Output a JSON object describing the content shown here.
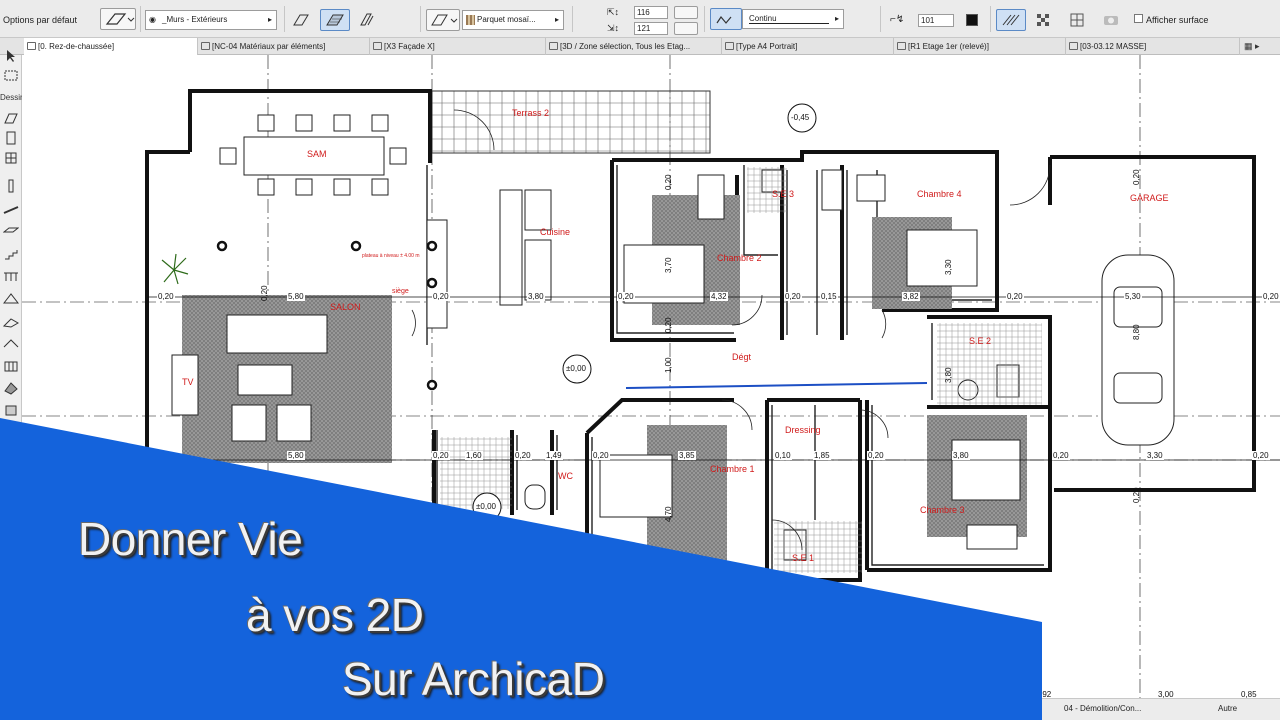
{
  "infobox": {
    "options_label": "Options par défaut",
    "layer_select": "_Murs - Extérieurs",
    "surface_select": "Parquet mosaï...",
    "height_top": "116",
    "height_bottom": "121",
    "line_type": "Continu",
    "pen_value": "101",
    "show_surface_label": "Afficher surface"
  },
  "tabs": [
    {
      "label": "[0. Rez-de-chaussée]"
    },
    {
      "label": "[NC-04 Matériaux par éléments]"
    },
    {
      "label": "[X3 Façade X]"
    },
    {
      "label": "[3D / Zone sélection, Tous les Etag..."
    },
    {
      "label": "[Type A4 Portrait]"
    },
    {
      "label": "[R1 Etage 1er (relevé)]"
    },
    {
      "label": "[03-03.12 MASSE]"
    }
  ],
  "toolbox": {
    "dessin_label": "Dessin"
  },
  "rooms": {
    "sam": "SAM",
    "terrasse": "Terrass 2",
    "cuisine": "Cuisine",
    "salon": "SALON",
    "chambre2": "Chambre 2",
    "chambre4": "Chambre 4",
    "se3": "S.E 3",
    "garage": "GARAGE",
    "se2": "S.E 2",
    "degt": "Dégt",
    "dressing": "Dressing",
    "chambre1": "Chambre 1",
    "chambre3": "Chambre 3",
    "se1": "S.E 1",
    "wc": "WC",
    "tv": "TV",
    "siege": "siège",
    "note": "plateau à niveau ± 4.00 m"
  },
  "dimensions": {
    "d_020_a": "0,20",
    "d_580_top": "5,80",
    "d_020_b": "0,20",
    "d_380": "3,80",
    "d_020_c": "0,20",
    "d_432": "4,32",
    "d_020_d": "0,20",
    "d_015": "0,15",
    "d_382": "3,82",
    "d_020_e": "0,20",
    "d_530": "5,30",
    "d_020_f": "0,20",
    "d_580_bot": "5,80",
    "d_020_g": "0,20",
    "d_160": "1,60",
    "d_020_h": "0,20",
    "d_149": "1,49",
    "d_020_i": "0,20",
    "d_385": "3,85",
    "d_010": "0,10",
    "d_185": "1,85",
    "d_020_j": "0,20",
    "d_380_b": "3,80",
    "d_020_k": "0,20",
    "d_330": "3,30",
    "d_020_l": "0,20",
    "v_020_a": "0,20",
    "v_370": "3,70",
    "v_330": "3,30",
    "v_020_b": "0,20",
    "v_880": "8,80",
    "v_020_c": "0,20",
    "v_100": "1,00",
    "v_380": "3,80",
    "v_470": "4,70",
    "v_020_d": "0,20",
    "v_020_e": "0,20",
    "lvl_045": "-0,45",
    "lvl_000": "±0,00",
    "lvl_000_b": "±0,00",
    "bottom_a": "3,00",
    "bottom_b": "0,85",
    "bottom_c": "-0,92"
  },
  "banner": {
    "line1": "Donner Vie",
    "line2": "à vos 2D",
    "line3": "Sur ArchicaD",
    "color": "#1463dc"
  },
  "status": {
    "view_label": "04 - Démolition/Con...",
    "scope_label": "Autre"
  }
}
